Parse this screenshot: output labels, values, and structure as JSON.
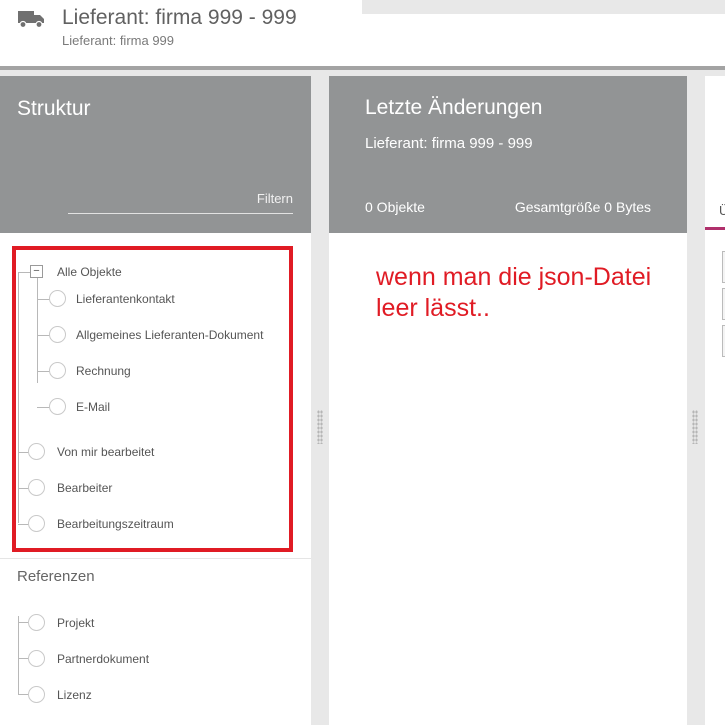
{
  "header": {
    "title": "Lieferant: firma 999 - 999",
    "subtitle": "Lieferant: firma 999",
    "icon": "truck-icon"
  },
  "structure_panel": {
    "title": "Struktur",
    "filter_label": "Filtern",
    "tree": {
      "root": "Alle Objekte",
      "root_children": [
        "Lieferantenkontakt",
        "Allgemeines Lieferanten-Dokument",
        "Rechnung",
        "E-Mail"
      ],
      "siblings": [
        "Von mir bearbeitet",
        "Bearbeiter",
        "Bearbeitungszeitraum"
      ]
    },
    "references": {
      "title": "Referenzen",
      "items": [
        "Projekt",
        "Partnerdokument",
        "Lizenz"
      ]
    }
  },
  "recent_panel": {
    "title": "Letzte Änderungen",
    "subtitle": "Lieferant: firma 999 - 999",
    "object_count": "0 Objekte",
    "total_size": "Gesamtgröße 0 Bytes"
  },
  "annotation": {
    "text": "wenn man die json-Datei leer lässt.."
  },
  "right_panel": {
    "tab_letter": "Ü"
  },
  "colors": {
    "panel_header": "#929495",
    "highlight_border": "#e01b24",
    "annotation_text": "#e01b24",
    "tab_accent": "#b0306c"
  }
}
